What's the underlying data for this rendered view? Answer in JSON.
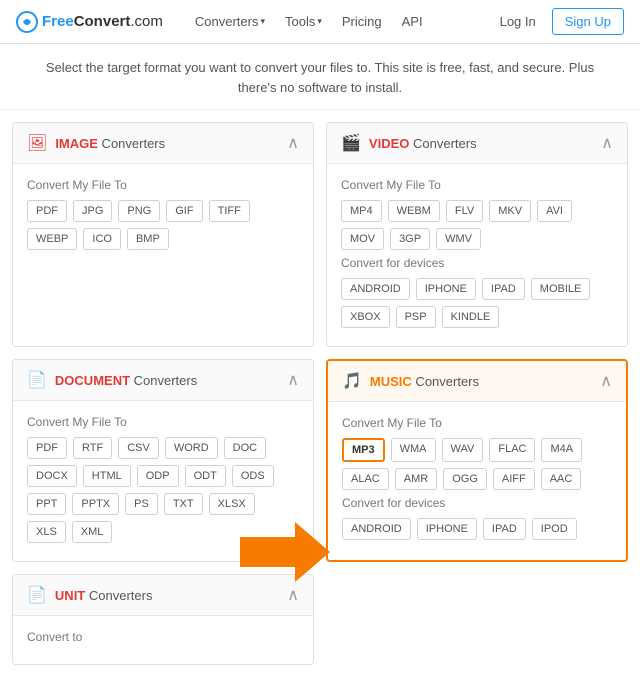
{
  "nav": {
    "logo_blue": "Free",
    "logo_black": "Convert",
    "logo_domain": ".com",
    "links": [
      {
        "label": "Converters",
        "hasChevron": true
      },
      {
        "label": "Tools",
        "hasChevron": true
      },
      {
        "label": "Pricing",
        "hasChevron": false
      },
      {
        "label": "API",
        "hasChevron": false
      }
    ],
    "login": "Log In",
    "signup": "Sign Up"
  },
  "subtitle": {
    "line1": "Select the target format you want to convert your files to. This site is free, fast, and secure. Plus",
    "line2": "there's no software to install."
  },
  "image_card": {
    "title_bold": "IMAGE",
    "title_rest": " Converters",
    "section_label": "Convert My File To",
    "formats": [
      "PDF",
      "JPG",
      "PNG",
      "GIF",
      "TIFF",
      "WEBP",
      "ICO",
      "BMP"
    ]
  },
  "video_card": {
    "title_bold": "VIDEO",
    "title_rest": " Converters",
    "section_label": "Convert My File To",
    "formats": [
      "MP4",
      "WEBM",
      "FLV",
      "MKV",
      "AVI",
      "MOV",
      "3GP",
      "WMV"
    ],
    "devices_label": "Convert for devices",
    "devices": [
      "ANDROID",
      "IPHONE",
      "IPAD",
      "MOBILE",
      "XBOX",
      "PSP",
      "KINDLE"
    ]
  },
  "document_card": {
    "title_bold": "DOCUMENT",
    "title_rest": " Converters",
    "section_label": "Convert My File To",
    "formats": [
      "PDF",
      "RTF",
      "CSV",
      "WORD",
      "DOC",
      "DOCX",
      "HTML",
      "ODP",
      "ODT",
      "ODS",
      "PPT",
      "PPTX",
      "PS",
      "TXT",
      "XLSX",
      "XLS",
      "XML"
    ]
  },
  "music_card": {
    "title_bold": "MUSIC",
    "title_rest": " Converters",
    "section_label": "Convert My File To",
    "formats": [
      "MP3",
      "WMA",
      "WAV",
      "FLAC",
      "M4A",
      "ALAC",
      "AMR",
      "OGG",
      "AIFF",
      "AAC"
    ],
    "highlighted_format": "MP3",
    "devices_label": "Convert for devices",
    "devices": [
      "ANDROID",
      "IPHONE",
      "IPAD",
      "IPOD"
    ]
  },
  "unit_card": {
    "title_bold": "UNIT",
    "title_rest": " Converters",
    "section_label": "Convert to"
  }
}
